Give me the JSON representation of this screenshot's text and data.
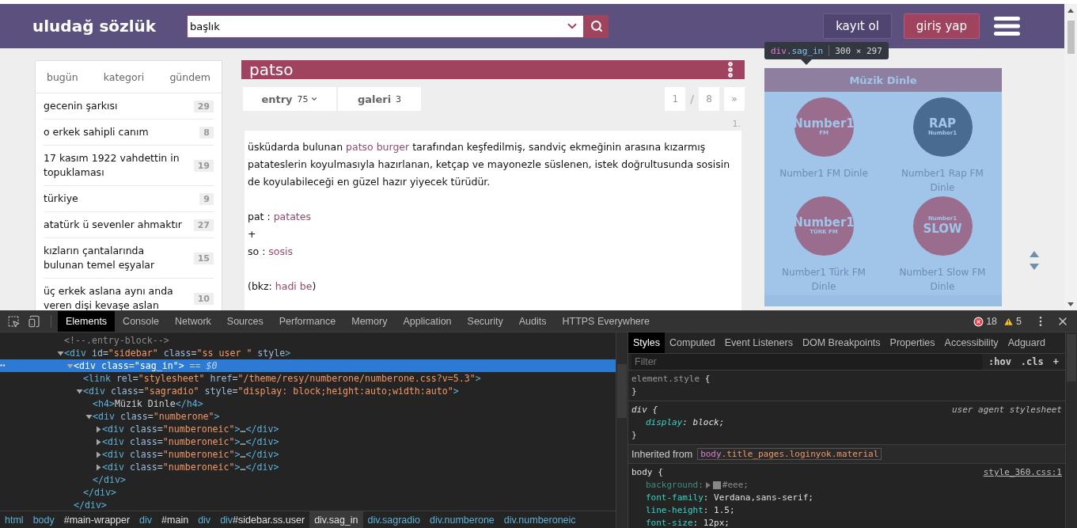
{
  "header": {
    "logo": "uludağ sözlük",
    "search": {
      "value": "başlık"
    },
    "buttons": [
      {
        "label": "kayıt ol",
        "kind": "outline"
      },
      {
        "label": "giriş yap",
        "kind": "primary"
      }
    ]
  },
  "inspect_tooltip": {
    "selector": "div.sag_in",
    "size": "300 × 297"
  },
  "sidebar": {
    "tabs": [
      "bugün",
      "kategori",
      "gündem"
    ],
    "topics": [
      {
        "title": "gecenin şarkısı",
        "count": "29"
      },
      {
        "title": "o erkek sahipli canım",
        "count": "8"
      },
      {
        "title": "17 kasım 1922 vahdettin in topuklaması",
        "count": "19"
      },
      {
        "title": "türkiye",
        "count": "9"
      },
      {
        "title": "atatürk ü sevenler ahmaktır",
        "count": "27"
      },
      {
        "title": "kızların çantalarında bulunan temel eşyalar",
        "count": "15"
      },
      {
        "title": "üç erkek aslana aynı anda veren dişi kevaşe aslan",
        "count": "10"
      }
    ]
  },
  "topic": {
    "title": "patso",
    "tabs": [
      {
        "label": "entry",
        "count": "75",
        "dropdown": true
      },
      {
        "label": "galeri",
        "count": "3",
        "dropdown": false
      }
    ],
    "pagination": {
      "current": "1",
      "separator": "/",
      "total": "8",
      "next": "»"
    },
    "entries": [
      {
        "number": "1.",
        "paragraphs": [
          [
            [
              {
                "text": "üsküdarda bulunan ",
                "link": false
              },
              {
                "text": "patso burger",
                "link": true
              },
              {
                "text": " tarafından keşfedilmiş, sandviç ekmeğinin arasına kızarmış patateslerin koyulmasıyla hazırlanan, ketçap ve mayonezle süslenen, istek doğrultusunda sosisin de koyulabileceği en güzel hazır yiyecek türüdür.",
                "link": false
              }
            ]
          ],
          [
            [
              {
                "text": "pat : ",
                "link": false
              },
              {
                "text": "patates",
                "link": true
              }
            ],
            [
              {
                "text": "+",
                "link": false
              }
            ],
            [
              {
                "text": "so : ",
                "link": false
              },
              {
                "text": "sosis",
                "link": true
              }
            ]
          ],
          [
            [
              {
                "text": "(bkz: ",
                "link": false
              },
              {
                "text": "hadi be",
                "link": true
              },
              {
                "text": ")",
                "link": false
              }
            ]
          ]
        ]
      }
    ]
  },
  "radio": {
    "title": "Müzik Dinle",
    "stations": [
      {
        "name": "Number1 FM Dinle",
        "color": "#9a6c8e",
        "logo": [
          {
            "text": "Number1",
            "kind": "main"
          },
          {
            "text": "FM",
            "kind": "sub"
          }
        ]
      },
      {
        "name": "Number1 Rap FM Dinle",
        "color": "#4a6b91",
        "logo": [
          {
            "text": "RAP",
            "kind": "main"
          },
          {
            "text": "Number1",
            "kind": "sub"
          }
        ]
      },
      {
        "name": "Number1 Türk FM Dinle",
        "color": "#9a6c8e",
        "logo": [
          {
            "text": "Number1",
            "kind": "main"
          },
          {
            "text": "TÜRK FM",
            "kind": "sub"
          }
        ]
      },
      {
        "name": "Number1 Slow FM Dinle",
        "color": "#9a6c8e",
        "logo": [
          {
            "text": "Number1",
            "kind": "sub"
          },
          {
            "text": "SLOW",
            "kind": "main"
          }
        ]
      }
    ]
  },
  "devtools": {
    "tabs": [
      {
        "label": "Elements",
        "selected": true
      },
      {
        "label": "Console",
        "selected": false
      },
      {
        "label": "Network",
        "selected": false
      },
      {
        "label": "Sources",
        "selected": false
      },
      {
        "label": "Performance",
        "selected": false
      },
      {
        "label": "Memory",
        "selected": false
      },
      {
        "label": "Application",
        "selected": false
      },
      {
        "label": "Security",
        "selected": false
      },
      {
        "label": "Audits",
        "selected": false
      },
      {
        "label": "HTTPS Everywhere",
        "selected": false
      }
    ],
    "errors": "18",
    "warnings": "5",
    "tree": [
      {
        "text": "<!--.entry-block-->",
        "selected": false
      },
      {
        "text": "<div id=\"sidebar\" class=\"ss user \" style>",
        "expanded": true,
        "selected": false,
        "children": [
          {
            "text": "<div class=\"sag_in\">",
            "suffix": "== $0",
            "expanded": true,
            "selected": true,
            "children": [
              {
                "text": "<link rel=\"stylesheet\" href=\"/theme/resy/numberone/numberone.css?v=5.3\">",
                "selected": false
              },
              {
                "text": "<div class=\"sagradio\" style=\"display: block;height:auto;width:auto\">",
                "expanded": true,
                "selected": false,
                "children": [
                  {
                    "text": "<h4>Müzik Dinle</h4>",
                    "selected": false
                  },
                  {
                    "text": "<div class=\"numberone\">",
                    "expanded": true,
                    "selected": false,
                    "children": [
                      {
                        "text": "<div class=\"numberoneic\">…</div>",
                        "expanded": false,
                        "selected": false
                      },
                      {
                        "text": "<div class=\"numberoneic\">…</div>",
                        "expanded": false,
                        "selected": false
                      },
                      {
                        "text": "<div class=\"numberoneic\">…</div>",
                        "expanded": false,
                        "selected": false
                      },
                      {
                        "text": "<div class=\"numberoneic\">…</div>",
                        "expanded": false,
                        "selected": false
                      }
                    ]
                  },
                  {
                    "text": "</div>",
                    "selected": false
                  }
                ]
              },
              {
                "text": "</div>",
                "selected": false
              }
            ]
          },
          {
            "text": "</div>",
            "selected": false
          }
        ]
      }
    ],
    "breadcrumbs": [
      {
        "label": "html",
        "selected": false
      },
      {
        "label": "body",
        "selected": false
      },
      {
        "label": "#main-wrapper",
        "selected": false
      },
      {
        "label": "div",
        "selected": false
      },
      {
        "label": "#main",
        "selected": false
      },
      {
        "label": "div",
        "selected": false
      },
      {
        "label": "div#sidebar.ss.user",
        "selected": false
      },
      {
        "label": "div.sag_in",
        "selected": true
      },
      {
        "label": "div.sagradio",
        "selected": false
      },
      {
        "label": "div.numberone",
        "selected": false
      },
      {
        "label": "div.numberoneic",
        "selected": false
      }
    ],
    "styles": {
      "tabs": [
        {
          "label": "Styles",
          "selected": true
        },
        {
          "label": "Computed",
          "selected": false
        },
        {
          "label": "Event Listeners",
          "selected": false
        },
        {
          "label": "DOM Breakpoints",
          "selected": false
        },
        {
          "label": "Properties",
          "selected": false
        },
        {
          "label": "Accessibility",
          "selected": false
        },
        {
          "label": "Adguard",
          "selected": false
        }
      ],
      "filter": {
        "placeholder": "Filter"
      },
      "actions": [
        ":hov",
        ".cls",
        "+"
      ],
      "rules": [
        {
          "kind": "inline",
          "selector": "element.style",
          "open": "{",
          "close": "}"
        },
        {
          "kind": "user-agent",
          "selector": "div",
          "open": "{",
          "close": "}",
          "source": "user agent stylesheet",
          "declarations": [
            {
              "text": "display: block;",
              "kind": "plain",
              "inactive": false
            }
          ]
        },
        {
          "kind": "inherited",
          "label": "Inherited from",
          "selector": "body.title_pages.loginyok.material"
        },
        {
          "kind": "normal",
          "selector": "body",
          "open": "{",
          "source": "style_360.css:1",
          "declarations": [
            {
              "text": "background: #eee;",
              "kind": "color",
              "inactive": true
            },
            {
              "text": "font-family: Verdana,sans-serif;",
              "kind": "plain",
              "inactive": false
            },
            {
              "text": "line-height: 1.5;",
              "kind": "plain",
              "inactive": false
            },
            {
              "text": "font-size: 12px;",
              "kind": "plain",
              "inactive": false
            }
          ]
        }
      ]
    }
  }
}
